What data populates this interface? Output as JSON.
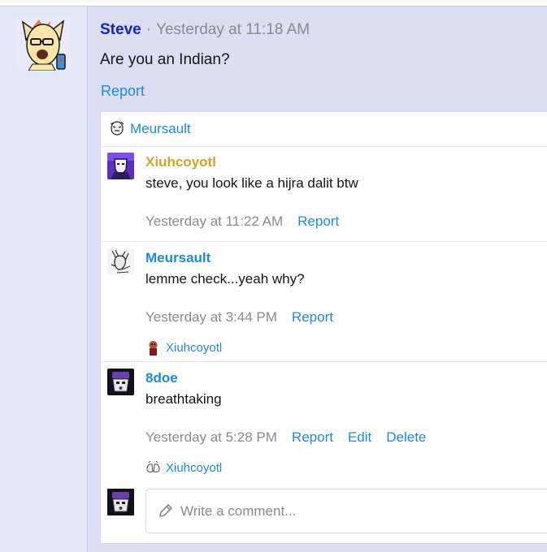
{
  "post": {
    "author": "Steve",
    "separator": "·",
    "time": "Yesterday at 11:18 AM",
    "text": "Are you an Indian?",
    "report_label": "Report"
  },
  "reaction": {
    "user": "Meursault"
  },
  "comments": [
    {
      "author": "Xiuhcoyotl",
      "text": "steve, you look like a hijra dalit btw",
      "time": "Yesterday at 11:22 AM",
      "report_label": "Report"
    },
    {
      "author": "Meursault",
      "text": "lemme check...yeah why?",
      "time": "Yesterday at 3:44 PM",
      "report_label": "Report",
      "liked_by": "Xiuhcoyotl"
    },
    {
      "author": "8doe",
      "text": "breathtaking",
      "time": "Yesterday at 5:28 PM",
      "report_label": "Report",
      "edit_label": "Edit",
      "delete_label": "Delete",
      "liked_by": "Xiuhcoyotl"
    }
  ],
  "composer": {
    "placeholder": "Write a comment..."
  },
  "icons": {
    "composer": "pencil-icon"
  },
  "colors": {
    "post_background": "#dcdff2",
    "gutter_background": "#e5e8f6",
    "author_main": "#1421d8",
    "link": "#1b8ae0",
    "gold_author": "#d6a224",
    "muted": "#8a8a8a"
  }
}
